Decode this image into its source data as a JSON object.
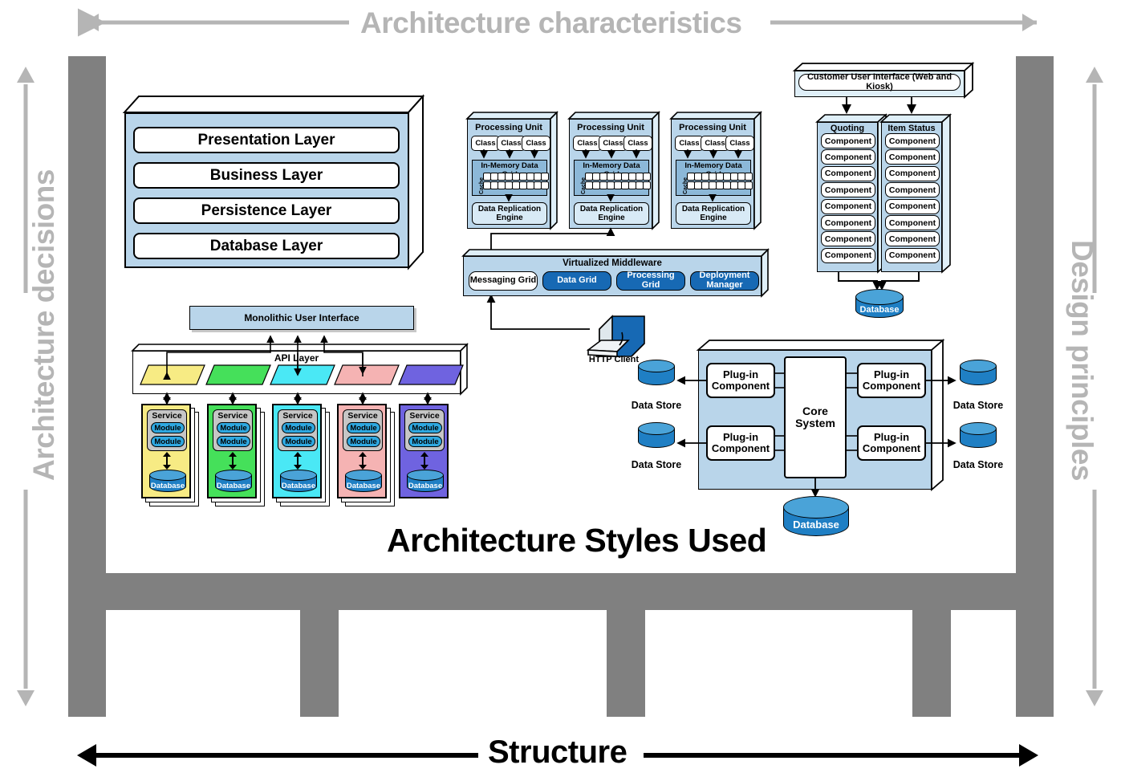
{
  "frame": {
    "top_label": "Architecture characteristics",
    "bottom_label": "Structure",
    "left_label": "Architecture decisions",
    "right_label": "Design principles",
    "main_title": "Architecture Styles Used",
    "frame_color": "#808080",
    "label_color": "#b5b5b5"
  },
  "layered_architecture": {
    "layers": [
      {
        "label": "Presentation Layer"
      },
      {
        "label": "Business Layer"
      },
      {
        "label": "Persistence Layer"
      },
      {
        "label": "Database Layer"
      }
    ],
    "fill_color": "#b9d5ea"
  },
  "space_based_architecture": {
    "processing_units": [
      {
        "title": "Processing Unit",
        "classes": [
          "Class",
          "Class",
          "Class"
        ],
        "grid_label": "In-Memory Data Grid",
        "cache_label": "Cache",
        "cache_rows": 2,
        "cache_cols": 9,
        "replication_label": "Data Replication Engine"
      },
      {
        "title": "Processing Unit",
        "classes": [
          "Class",
          "Class",
          "Class"
        ],
        "grid_label": "In-Memory Data Grid",
        "cache_label": "Cache",
        "cache_rows": 2,
        "cache_cols": 9,
        "replication_label": "Data Replication Engine"
      },
      {
        "title": "Processing Unit",
        "classes": [
          "Class",
          "Class",
          "Class"
        ],
        "grid_label": "In-Memory Data Grid",
        "cache_label": "Cache",
        "cache_rows": 2,
        "cache_cols": 9,
        "replication_label": "Data Replication Engine"
      }
    ],
    "middleware": {
      "title": "Virtualized Middleware",
      "grids": [
        {
          "label": "Messaging Grid",
          "fill": "#ffffff",
          "text_color": "#000000"
        },
        {
          "label": "Data Grid",
          "fill": "#1769b4",
          "text_color": "#ffffff"
        },
        {
          "label": "Processing Grid",
          "fill": "#1769b4",
          "text_color": "#ffffff"
        },
        {
          "label": "Deployment Manager",
          "fill": "#1769b4",
          "text_color": "#ffffff"
        }
      ]
    },
    "http_client_label": "HTTP Client"
  },
  "service_based_architecture": {
    "user_interface": "Customer User Interface (Web and Kiosk)",
    "services": [
      {
        "name": "Quoting Service",
        "components": [
          "Component",
          "Component",
          "Component",
          "Component",
          "Component",
          "Component",
          "Component",
          "Component"
        ]
      },
      {
        "name": "Item Status Service",
        "components": [
          "Component",
          "Component",
          "Component",
          "Component",
          "Component",
          "Component",
          "Component",
          "Component"
        ]
      }
    ],
    "database_label": "Database"
  },
  "microservices_architecture": {
    "ui_label": "Monolithic User Interface",
    "api_layer_label": "API Layer",
    "api_shapes": [
      {
        "color": "#f7eb84"
      },
      {
        "color": "#45e05a"
      },
      {
        "color": "#4ae8f5"
      },
      {
        "color": "#f5b3b3"
      },
      {
        "color": "#6f63e0"
      }
    ],
    "services": [
      {
        "color": "#f7eb84",
        "title": "Service",
        "modules": [
          "Module",
          "Module"
        ],
        "database_label": "Database"
      },
      {
        "color": "#45e05a",
        "title": "Service",
        "modules": [
          "Module",
          "Module"
        ],
        "database_label": "Database"
      },
      {
        "color": "#4ae8f5",
        "title": "Service",
        "modules": [
          "Module",
          "Module"
        ],
        "database_label": "Database"
      },
      {
        "color": "#f5b3b3",
        "title": "Service",
        "modules": [
          "Module",
          "Module"
        ],
        "database_label": "Database"
      },
      {
        "color": "#6f63e0",
        "title": "Service",
        "modules": [
          "Module",
          "Module"
        ],
        "database_label": "Database"
      }
    ]
  },
  "microkernel_architecture": {
    "core_label": "Core System",
    "plugins": [
      {
        "label": "Plug-in Component"
      },
      {
        "label": "Plug-in Component"
      },
      {
        "label": "Plug-in Component"
      },
      {
        "label": "Plug-in Component"
      }
    ],
    "data_stores": [
      {
        "label": "Data Store"
      },
      {
        "label": "Data Store"
      },
      {
        "label": "Data Store"
      },
      {
        "label": "Data Store"
      }
    ],
    "database_label": "Database"
  }
}
